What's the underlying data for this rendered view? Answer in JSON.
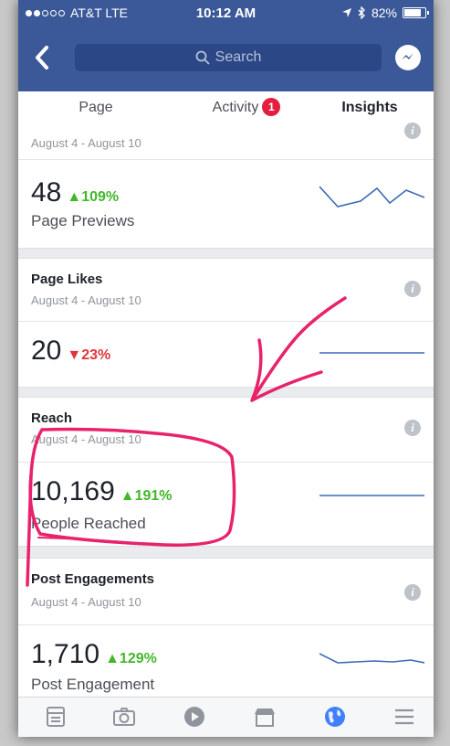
{
  "status_bar": {
    "carrier": "AT&T  LTE",
    "time": "10:12 AM",
    "battery": "82%"
  },
  "header": {
    "search_placeholder": "Search"
  },
  "tabs": [
    {
      "label": "Page"
    },
    {
      "label": "Activity",
      "badge": "1"
    },
    {
      "label": "Insights",
      "active": true
    }
  ],
  "cards": {
    "previews": {
      "date": "August 4 - August 10",
      "value": "48",
      "change": "109%",
      "direction": "up",
      "label": "Page Previews"
    },
    "likes": {
      "title": "Page Likes",
      "date": "August 4 - August 10",
      "value": "20",
      "change": "23%",
      "direction": "down"
    },
    "reach": {
      "title": "Reach",
      "date": "August 4 - August 10",
      "value": "10,169",
      "change": "191%",
      "direction": "up",
      "label": "People Reached"
    },
    "engagements": {
      "title": "Post Engagements",
      "date": "August 4 - August 10",
      "value": "1,710",
      "change": "129%",
      "direction": "up",
      "label": "Post Engagement"
    }
  },
  "bottom_nav": [
    "news-feed-icon",
    "camera-icon",
    "video-icon",
    "marketplace-icon",
    "globe-icon",
    "menu-icon"
  ],
  "colors": {
    "brand": "#3b5998",
    "up": "#42b72a",
    "down": "#e0353b",
    "annotation": "#e8226b",
    "sparkline": "#3b6bb5"
  }
}
